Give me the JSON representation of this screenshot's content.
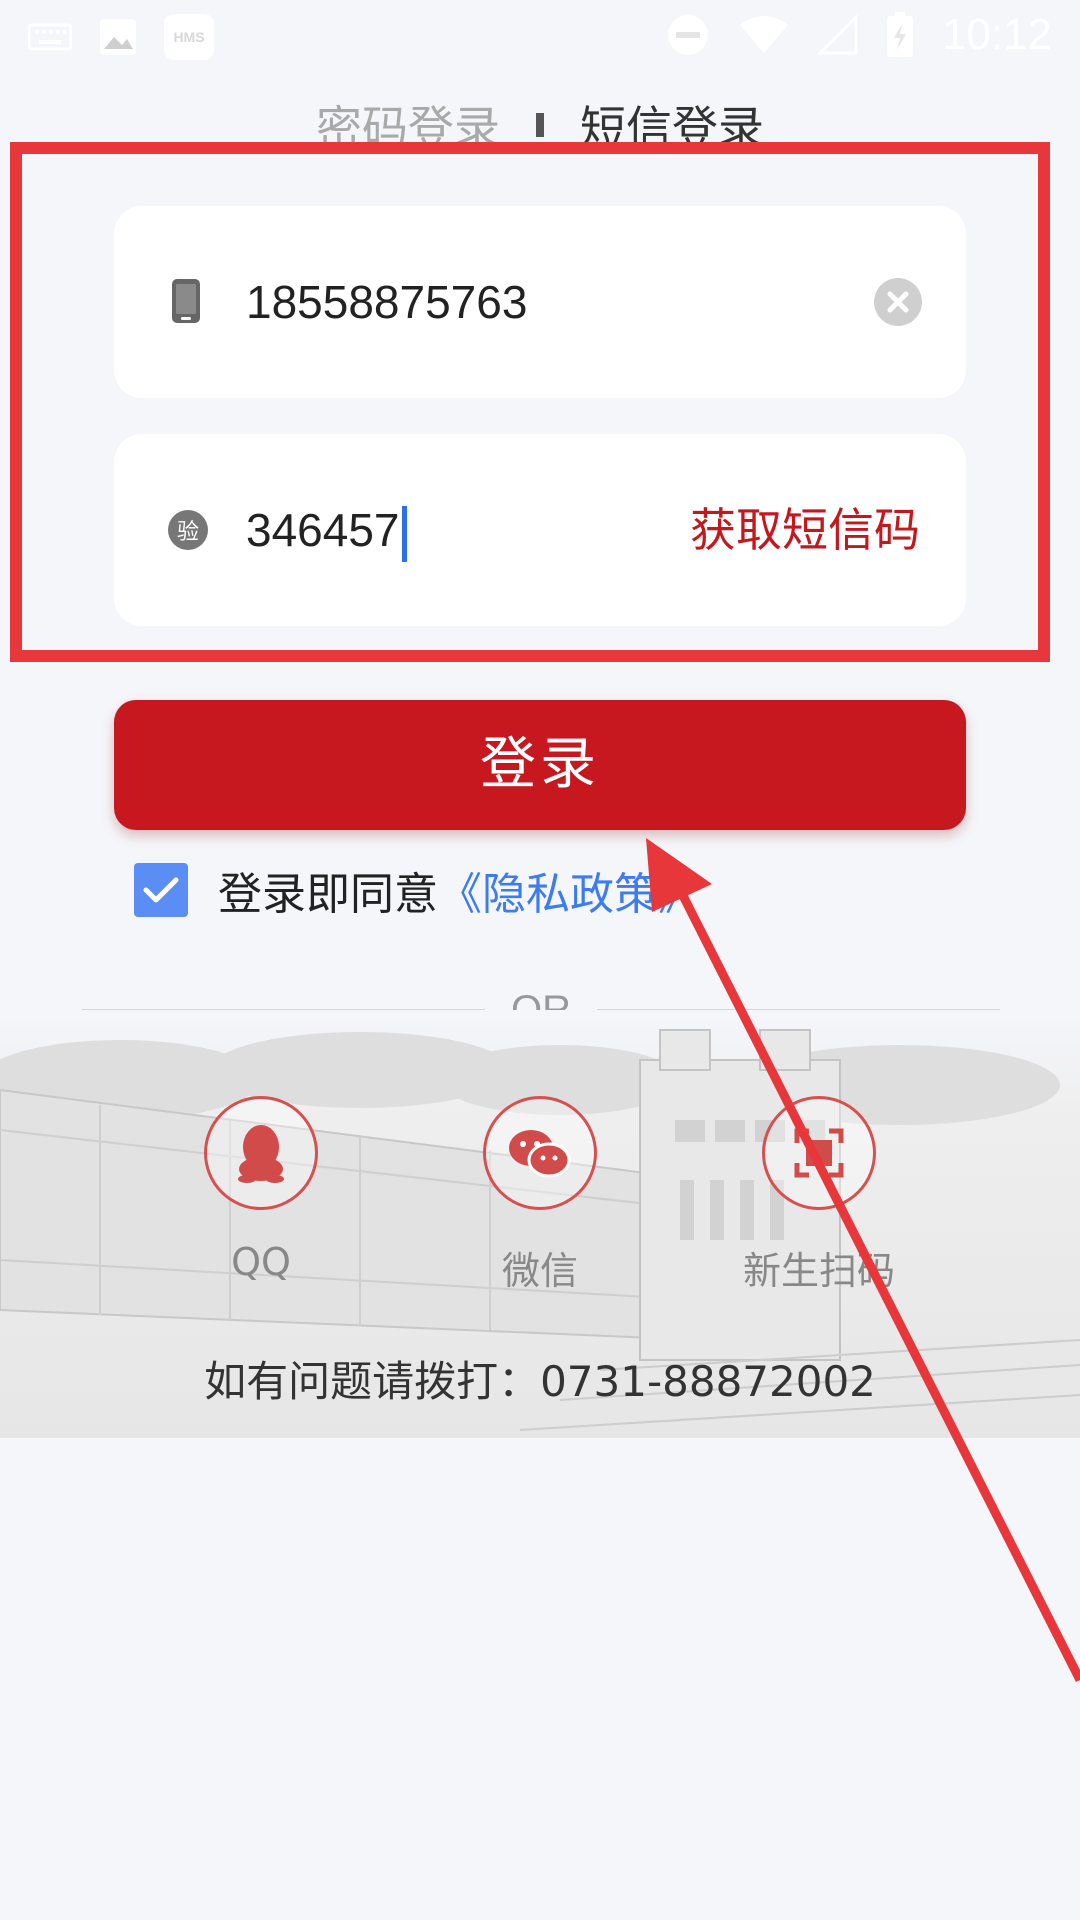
{
  "status_bar": {
    "time": "10:12",
    "icons": [
      "keyboard-icon",
      "image-icon",
      "hms-icon",
      "dnd-icon",
      "wifi-icon",
      "no-signal-icon",
      "battery-icon"
    ],
    "hms_text": "HMS"
  },
  "tabs": {
    "password_login": "密码登录",
    "sms_login": "短信登录",
    "active": "sms_login"
  },
  "form": {
    "phone_value": "18558875763",
    "code_value": "346457",
    "code_icon_text": "验",
    "get_code_label": "获取短信码"
  },
  "login_button": "登录",
  "agreement": {
    "checked": true,
    "text": "登录即同意",
    "link": "《隐私政策》"
  },
  "divider_text": "OR",
  "social": [
    {
      "label": "QQ",
      "icon": "qq-icon"
    },
    {
      "label": "微信",
      "icon": "wechat-icon"
    },
    {
      "label": "新生扫码",
      "icon": "scan-icon"
    }
  ],
  "hotline": "如有问题请拨打：0731-88872002",
  "colors": {
    "brand_red": "#c8181f",
    "annotation_red": "#e8373a",
    "link_blue": "#3d7cf0",
    "checkbox_blue": "#5a8ef5",
    "background": "#f5f6fa"
  }
}
